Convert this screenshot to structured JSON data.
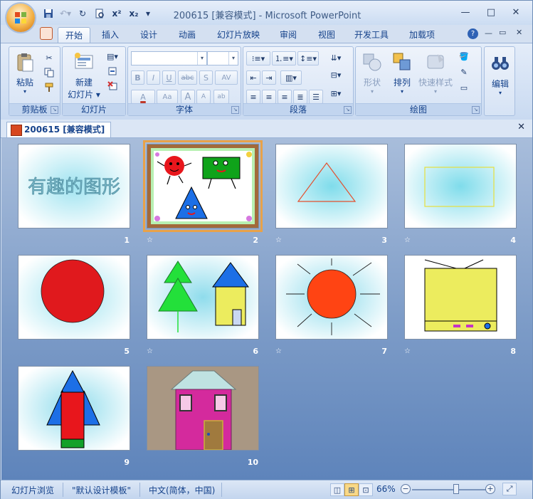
{
  "window": {
    "title": "200615 [兼容模式] - Microsoft PowerPoint"
  },
  "qat": {
    "save_icon": "save-icon",
    "undo_icon": "undo-icon",
    "redo_icon": "repeat-icon",
    "preview_icon": "print-preview-icon",
    "superscript_label": "x²",
    "subscript_label": "x₂",
    "customize_label": "▾"
  },
  "window_controls": {
    "minimize": "—",
    "maximize": "□",
    "close": "✕",
    "ribbon_help": "?",
    "ribbon_restore": "▭",
    "ribbon_close": "✕"
  },
  "tabs": [
    {
      "label": "开始",
      "active": true
    },
    {
      "label": "插入",
      "active": false
    },
    {
      "label": "设计",
      "active": false
    },
    {
      "label": "动画",
      "active": false
    },
    {
      "label": "幻灯片放映",
      "active": false
    },
    {
      "label": "审阅",
      "active": false
    },
    {
      "label": "视图",
      "active": false
    },
    {
      "label": "开发工具",
      "active": false
    },
    {
      "label": "加载项",
      "active": false
    }
  ],
  "ribbon": {
    "clipboard": {
      "label": "剪贴板",
      "paste": "粘贴"
    },
    "slides": {
      "label": "幻灯片",
      "new_slide_line1": "新建",
      "new_slide_line2": "幻灯片 ▾"
    },
    "font": {
      "label": "字体",
      "bold": "B",
      "italic": "I",
      "underline": "U",
      "strike": "abc",
      "shadow": "S",
      "spacing": "AV",
      "fontcolor": "A",
      "changecase": "Aa",
      "grow": "A",
      "shrink": "A",
      "clear": "ab"
    },
    "paragraph": {
      "label": "段落"
    },
    "drawing": {
      "label": "绘图",
      "shapes": "形状",
      "arrange": "排列",
      "quick_styles": "快速样式"
    },
    "editing": {
      "label": "编辑",
      "find_icon": "binoculars-icon"
    }
  },
  "document_tab": {
    "label": "200615 [兼容模式]",
    "close": "✕"
  },
  "slides": [
    {
      "num": "1",
      "title_text": "有趣的图形",
      "star": ""
    },
    {
      "num": "2",
      "star": "☆",
      "selected": true
    },
    {
      "num": "3",
      "star": "☆"
    },
    {
      "num": "4",
      "star": "☆"
    },
    {
      "num": "5",
      "star": ""
    },
    {
      "num": "6",
      "star": "☆"
    },
    {
      "num": "7",
      "star": "☆"
    },
    {
      "num": "8",
      "star": "☆"
    },
    {
      "num": "9",
      "star": ""
    },
    {
      "num": "10",
      "star": ""
    }
  ],
  "status": {
    "view_name": "幻灯片浏览",
    "theme": "\"默认设计模板\"",
    "language": "中文(简体，中国)",
    "zoom": "66%",
    "zoom_out": "−",
    "zoom_in": "+",
    "zoom_level": 0.66
  },
  "colors": {
    "accent": "#15428b",
    "sorter_top": "#a8bddb",
    "sorter_bottom": "#5e84bb"
  }
}
